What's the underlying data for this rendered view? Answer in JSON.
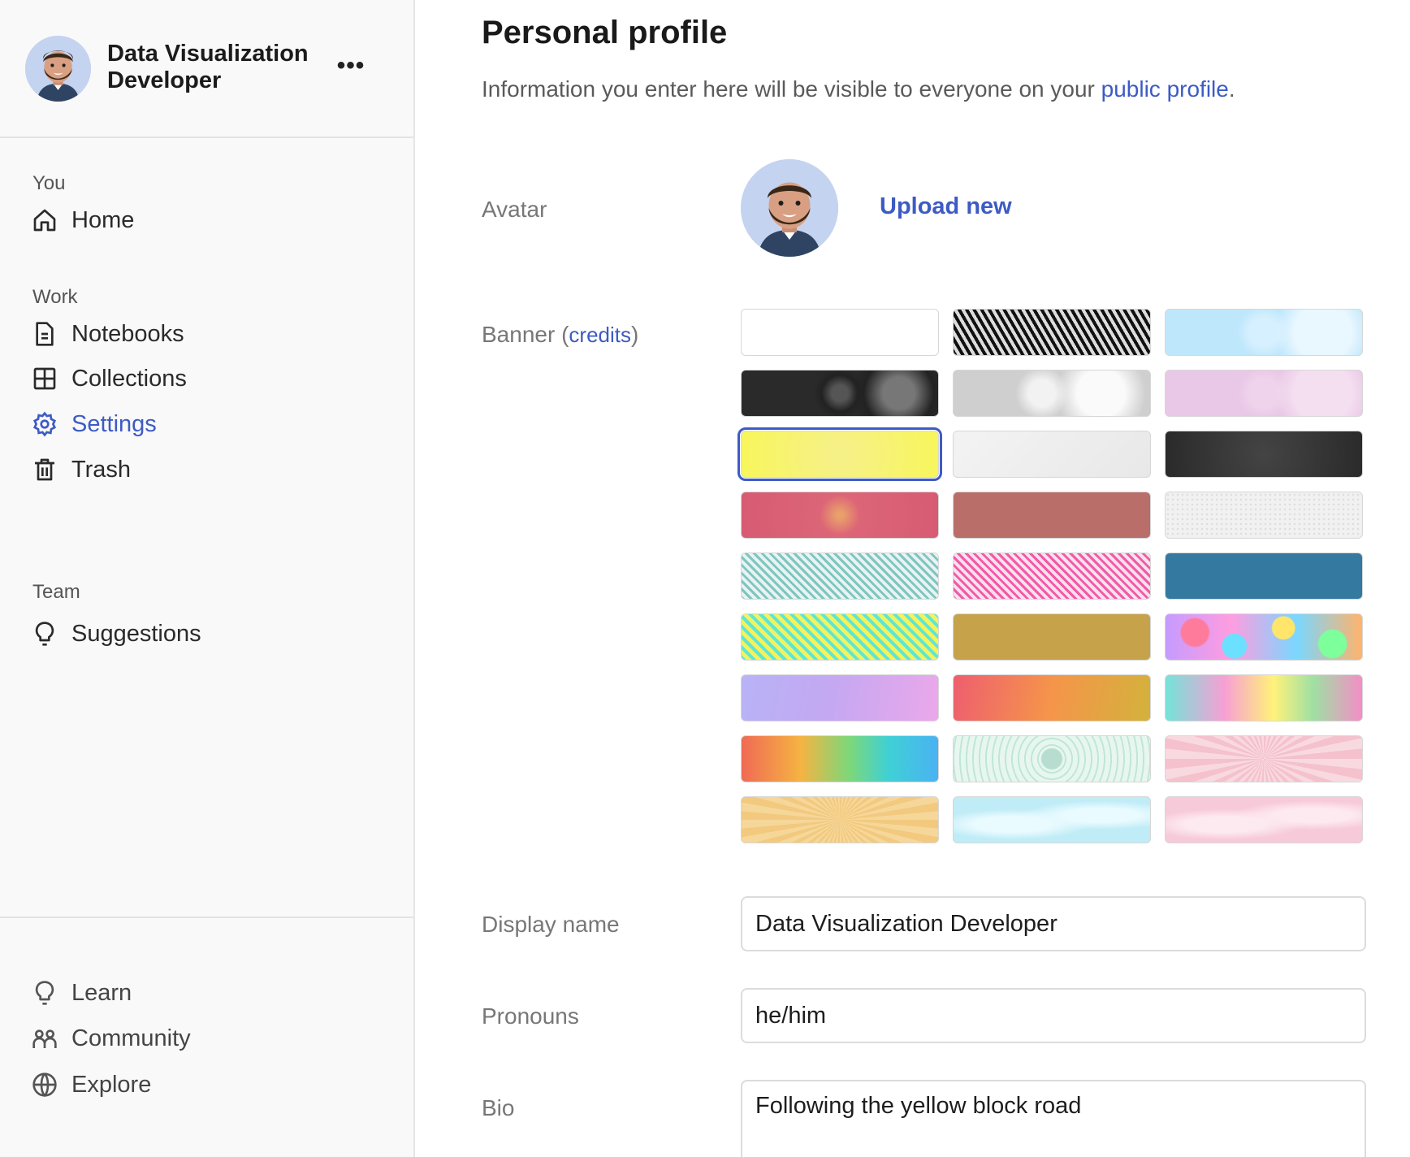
{
  "account": {
    "name": "Data Visualization Developer",
    "more_label": "•••",
    "avatar_icon": "bearded-man-avatar-icon"
  },
  "sidebar": {
    "sections": [
      {
        "label": "You"
      },
      {
        "label": "Work"
      },
      {
        "label": "Team"
      }
    ],
    "items": [
      {
        "label": "Home",
        "icon": "home-icon"
      },
      {
        "label": "Notebooks",
        "icon": "notebook-icon"
      },
      {
        "label": "Collections",
        "icon": "collections-grid-icon"
      },
      {
        "label": "Settings",
        "icon": "gear-icon",
        "active": true
      },
      {
        "label": "Trash",
        "icon": "trash-icon"
      },
      {
        "label": "Suggestions",
        "icon": "lightbulb-icon"
      }
    ],
    "footer_items": [
      {
        "label": "Learn",
        "icon": "lightbulb-icon"
      },
      {
        "label": "Community",
        "icon": "people-icon"
      },
      {
        "label": "Explore",
        "icon": "globe-icon"
      }
    ]
  },
  "main": {
    "title": "Personal profile",
    "description_prefix": "Information you enter here will be visible to everyone on your ",
    "description_link": "public profile",
    "description_suffix": ".",
    "avatar_label": "Avatar",
    "upload_label": "Upload new",
    "banner_label": "Banner",
    "banner_credits_open": " (",
    "banner_credits_link": "credits",
    "banner_credits_close": ")",
    "display_name_label": "Display name",
    "display_name_value": "Data Visualization Developer",
    "pronouns_label": "Pronouns",
    "pronouns_value": "he/him",
    "bio_label": "Bio",
    "bio_value": "Following the yellow block road"
  },
  "colors": {
    "accent": "#3d5bc4",
    "sidebar_bg": "#f9f9f9"
  },
  "banners": [
    {
      "name": "banner-blank",
      "style": "background:#ffffff"
    },
    {
      "name": "banner-bw-moire",
      "style": "background:repeating-linear-gradient(60deg,#111 0 4px,#ddd 4px 8px),#888"
    },
    {
      "name": "banner-light-blue-spheres",
      "style": "background:radial-gradient(circle at 80% 50%,#e9f7ff 0 18%,transparent 30%),radial-gradient(circle at 50% 50%,#d6f0ff 0 14%,transparent 26%),#bfe7fc"
    },
    {
      "name": "banner-dark-spheres",
      "style": "background:radial-gradient(circle at 80% 50%,#777 0 10%,#222 22%,transparent 30%),radial-gradient(circle at 50% 50%,#555 0 8%,#222 18%,transparent 26%),#2a2a2a"
    },
    {
      "name": "banner-grey-spheres",
      "style": "background:radial-gradient(circle at 75% 50%,#fafafa 0 16%,transparent 30%),radial-gradient(circle at 45% 50%,#f2f2f2 0 12%,transparent 24%),#cfcfcf"
    },
    {
      "name": "banner-pink-spheres",
      "style": "background:radial-gradient(circle at 80% 50%,#f4dff0 0 18%,transparent 30%),radial-gradient(circle at 50% 50%,#efd3ec 0 14%,transparent 26%),#e9c7e6"
    },
    {
      "name": "banner-yellow",
      "style": "background:radial-gradient(circle at 50% 50%,#f6f08a,#f8f65c)",
      "selected": true
    },
    {
      "name": "banner-white-grey",
      "style": "background:linear-gradient(135deg,#f3f3f3,#e8e8e8)"
    },
    {
      "name": "banner-dark-charcoal",
      "style": "background:radial-gradient(circle at 50% 50%,#444,#2a2a2a)"
    },
    {
      "name": "banner-pink-red",
      "style": "background:radial-gradient(circle at 50% 50%,#e9a06b 0 3%,#dc6577 20%,#d75b73)"
    },
    {
      "name": "banner-terracotta",
      "style": "background:#b96e69"
    },
    {
      "name": "banner-light-dots",
      "style": "background:radial-gradient(#ddd 1px,transparent 1.5px) 0 0/6px 6px,#f1f1f1"
    },
    {
      "name": "banner-teal-maze",
      "style": "background:repeating-linear-gradient(45deg,#7fc5c0 0 3px,#e8f3f2 3px 7px),#9fd1cc"
    },
    {
      "name": "banner-pink-maze",
      "style": "background:repeating-linear-gradient(45deg,#ef5ba7 0 3px,#fbe0ee 3px 7px),#f07bb8"
    },
    {
      "name": "banner-steel-blue",
      "style": "background:#3379a0"
    },
    {
      "name": "banner-green-yellow-maze",
      "style": "background:repeating-linear-gradient(45deg,#5ee6d5 0 4px,#f2f35e 4px 9px)"
    },
    {
      "name": "banner-mustard",
      "style": "background:#c6a34a"
    },
    {
      "name": "banner-confetti",
      "style": "background:radial-gradient(circle at 15% 40%,#ff7b9c 0 8%,transparent 9%),radial-gradient(circle at 35% 70%,#6be0ff 0 9%,transparent 10%),radial-gradient(circle at 60% 30%,#ffe66b 0 9%,transparent 10%),radial-gradient(circle at 85% 65%,#7dff9b 0 8%,transparent 9%),linear-gradient(90deg,#c59bff,#ff9de0,#7ad7ff,#ffb36b)"
    },
    {
      "name": "banner-lavender-poly",
      "style": "background:linear-gradient(100deg,#b8b3f6,#c4a8f2 45%,#eba8ea)"
    },
    {
      "name": "banner-orange-poly",
      "style": "background:linear-gradient(100deg,#ee5e6f,#f5954a 50%,#d3b23c)"
    },
    {
      "name": "banner-pastel-poly",
      "style": "background:linear-gradient(90deg,#74e3d9,#f79fd4 30%,#fff27a 55%,#9fe0a3 75%,#f38ec6)"
    },
    {
      "name": "banner-rainbow",
      "style": "background:linear-gradient(90deg,#f06a55,#f5b342 30%,#7cd87a 55%,#3fd0d6 75%,#4ab2f2)"
    },
    {
      "name": "banner-mint-lace",
      "style": "background:radial-gradient(circle at 50% 50%,#b7ddd0 0 10%,transparent 11%),repeating-radial-gradient(circle at 50% 50%,#bfe7d8 0 2px,#e8f6f0 2px 8px)"
    },
    {
      "name": "banner-pink-burst",
      "style": "background:repeating-conic-gradient(from 0deg at 50% 50%,#f4c1cc 0 6deg,#f9d9e0 6deg 12deg)"
    },
    {
      "name": "banner-peach-burst",
      "style": "background:repeating-conic-gradient(from 0deg at 50% 50%,#f2c97e 0 5deg,#f6d79a 5deg 10deg)"
    },
    {
      "name": "banner-sky-swirl",
      "style": "background:radial-gradient(ellipse at 30% 60%,#e9fbff 0 20%,transparent 40%),radial-gradient(ellipse at 75% 40%,#e9fbff 0 18%,transparent 38%),#bfecf6"
    },
    {
      "name": "banner-pink-swirl",
      "style": "background:radial-gradient(ellipse at 30% 60%,#fdeaf1 0 20%,transparent 40%),radial-gradient(ellipse at 75% 40%,#fdeaf1 0 18%,transparent 38%),#f7cad9"
    }
  ]
}
